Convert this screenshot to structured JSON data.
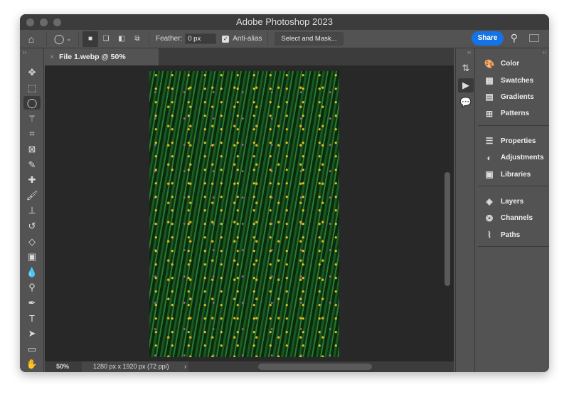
{
  "window": {
    "title": "Adobe Photoshop 2023"
  },
  "options": {
    "feather_label": "Feather:",
    "feather_value": "0 px",
    "antialias_label": "Anti-alias",
    "antialias_checked": true,
    "select_mask_label": "Select and Mask...",
    "share_label": "Share"
  },
  "tools": [
    {
      "name": "move",
      "glyph": "✥"
    },
    {
      "name": "rect-marquee",
      "glyph": "⬚"
    },
    {
      "name": "lasso",
      "glyph": "◯",
      "selected": true
    },
    {
      "name": "magic-wand",
      "glyph": "⚚"
    },
    {
      "name": "crop",
      "glyph": "⌗"
    },
    {
      "name": "frame",
      "glyph": "⊠"
    },
    {
      "name": "eyedropper",
      "glyph": "✎"
    },
    {
      "name": "healing-brush",
      "glyph": "✚"
    },
    {
      "name": "brush",
      "glyph": "🖌"
    },
    {
      "name": "clone-stamp",
      "glyph": "⊥"
    },
    {
      "name": "history-brush",
      "glyph": "↺"
    },
    {
      "name": "eraser",
      "glyph": "◇"
    },
    {
      "name": "gradient",
      "glyph": "▣"
    },
    {
      "name": "blur",
      "glyph": "💧"
    },
    {
      "name": "dodge",
      "glyph": "⚲"
    },
    {
      "name": "pen",
      "glyph": "✒"
    },
    {
      "name": "type",
      "glyph": "T"
    },
    {
      "name": "path-selection",
      "glyph": "➤"
    },
    {
      "name": "rectangle",
      "glyph": "▭"
    },
    {
      "name": "hand",
      "glyph": "✋"
    }
  ],
  "document": {
    "tab_title": "File 1.webp @ 50% (RGB/8#)",
    "zoom": "50%",
    "info": "1280 px x 1920 px (72 ppi)"
  },
  "panels": [
    [
      {
        "label": "Color",
        "icon": "🎨"
      },
      {
        "label": "Swatches",
        "icon": "▦"
      },
      {
        "label": "Gradients",
        "icon": "▤"
      },
      {
        "label": "Patterns",
        "icon": "⊞"
      }
    ],
    [
      {
        "label": "Properties",
        "icon": "☰"
      },
      {
        "label": "Adjustments",
        "icon": "◐"
      },
      {
        "label": "Libraries",
        "icon": "▣"
      }
    ],
    [
      {
        "label": "Layers",
        "icon": "◈"
      },
      {
        "label": "Channels",
        "icon": "❂"
      },
      {
        "label": "Paths",
        "icon": "⌇"
      }
    ]
  ]
}
